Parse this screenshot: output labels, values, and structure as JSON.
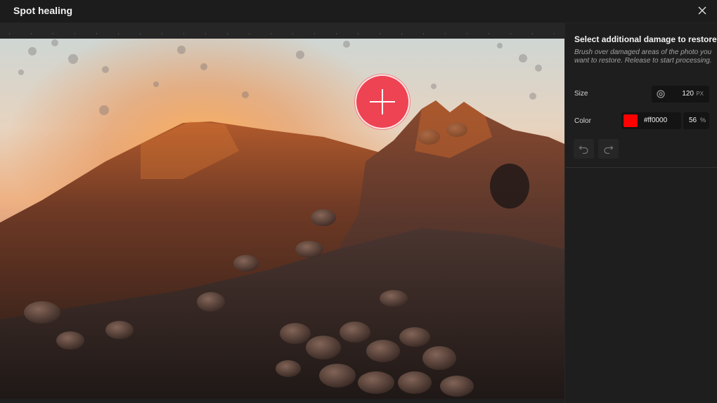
{
  "header": {
    "title": "Spot healing",
    "close_icon": "close-icon"
  },
  "canvas": {
    "image_subject": "mountain-sunset-photo",
    "brush_icon": "plus-icon",
    "brush_color": "#ee4353"
  },
  "panel": {
    "heading": "Select additional damage to restore",
    "description": "Brush over damaged areas of the photo you want to restore. Release to start processing.",
    "size": {
      "label": "Size",
      "icon": "target-icon",
      "value": "120",
      "unit": "PX"
    },
    "color": {
      "label": "Color",
      "swatch": "#ff0000",
      "hex": "#ff0000",
      "opacity": "56",
      "opacity_unit": "%"
    },
    "history": {
      "undo_icon": "undo-icon",
      "redo_icon": "redo-icon"
    }
  }
}
